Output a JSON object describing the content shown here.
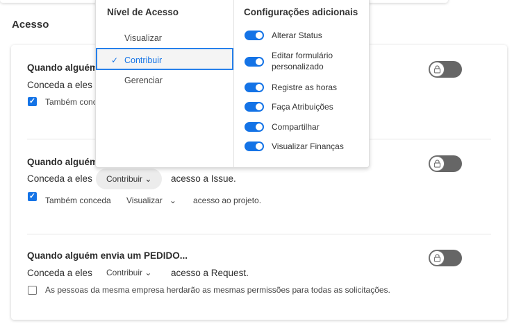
{
  "section_title": "Acesso",
  "rows": [
    {
      "title": "Quando alguém",
      "grant_prefix": "Conceda a eles",
      "also_grant": "Também conceda"
    },
    {
      "title": "Quando alguém",
      "grant_prefix": "Conceda a eles",
      "level": "Contribuir",
      "grant_suffix": "acesso a Issue.",
      "also_grant": "Também conceda",
      "project_level": "Visualizar",
      "project_suffix": "acesso ao projeto."
    },
    {
      "title": "Quando alguém envia um PEDIDO...",
      "grant_prefix": "Conceda a eles",
      "level": "Contribuir",
      "grant_suffix": "acesso a Request.",
      "inherit_label": "As pessoas da mesma empresa herdarão as mesmas permissões para todas as solicitações."
    }
  ],
  "popup": {
    "access_header": "Nível de Acesso",
    "options": [
      "Visualizar",
      "Contribuir",
      "Gerenciar"
    ],
    "selected": "Contribuir",
    "settings_header": "Configurações adicionais",
    "settings": [
      "Alterar Status",
      "Editar formulário personalizado",
      "Registre as horas",
      "Faça Atribuições",
      "Compartilhar",
      "Visualizar Finanças"
    ]
  },
  "colors": {
    "accent": "#1473e6",
    "lock_toggle": "#666666"
  }
}
